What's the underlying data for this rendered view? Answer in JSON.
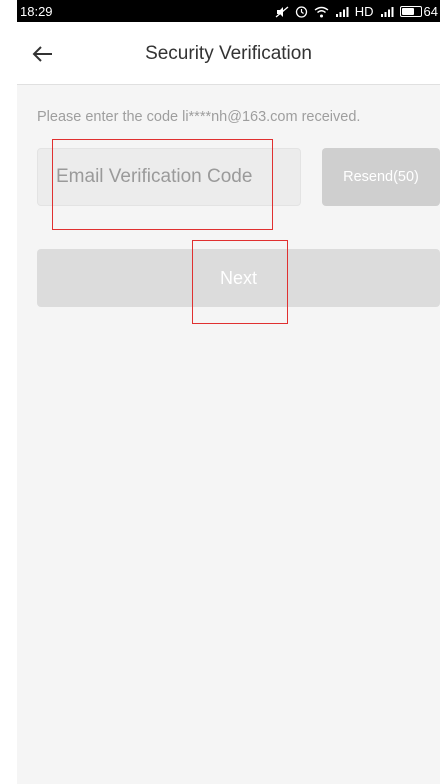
{
  "status_bar": {
    "time": "18:29",
    "network_label": "HD",
    "battery_level": "64",
    "battery_percent": 0.64,
    "icons": [
      "mute-icon",
      "alarm-icon",
      "wifi-icon",
      "signal-icon",
      "signal-icon",
      "battery-icon"
    ]
  },
  "header": {
    "back_icon": "arrow-left-icon",
    "title": "Security Verification"
  },
  "verification": {
    "hint": "Please enter the code li****nh@163.com received.",
    "code_value": "",
    "code_placeholder": "Email Verification Code",
    "resend_label": "Resend(50)"
  },
  "actions": {
    "next_label": "Next"
  },
  "colors": {
    "status_bar": "#000000",
    "button_disabled": "#dcdcdc",
    "resend_disabled": "#cfcfcf",
    "annotation": "#e03030"
  }
}
